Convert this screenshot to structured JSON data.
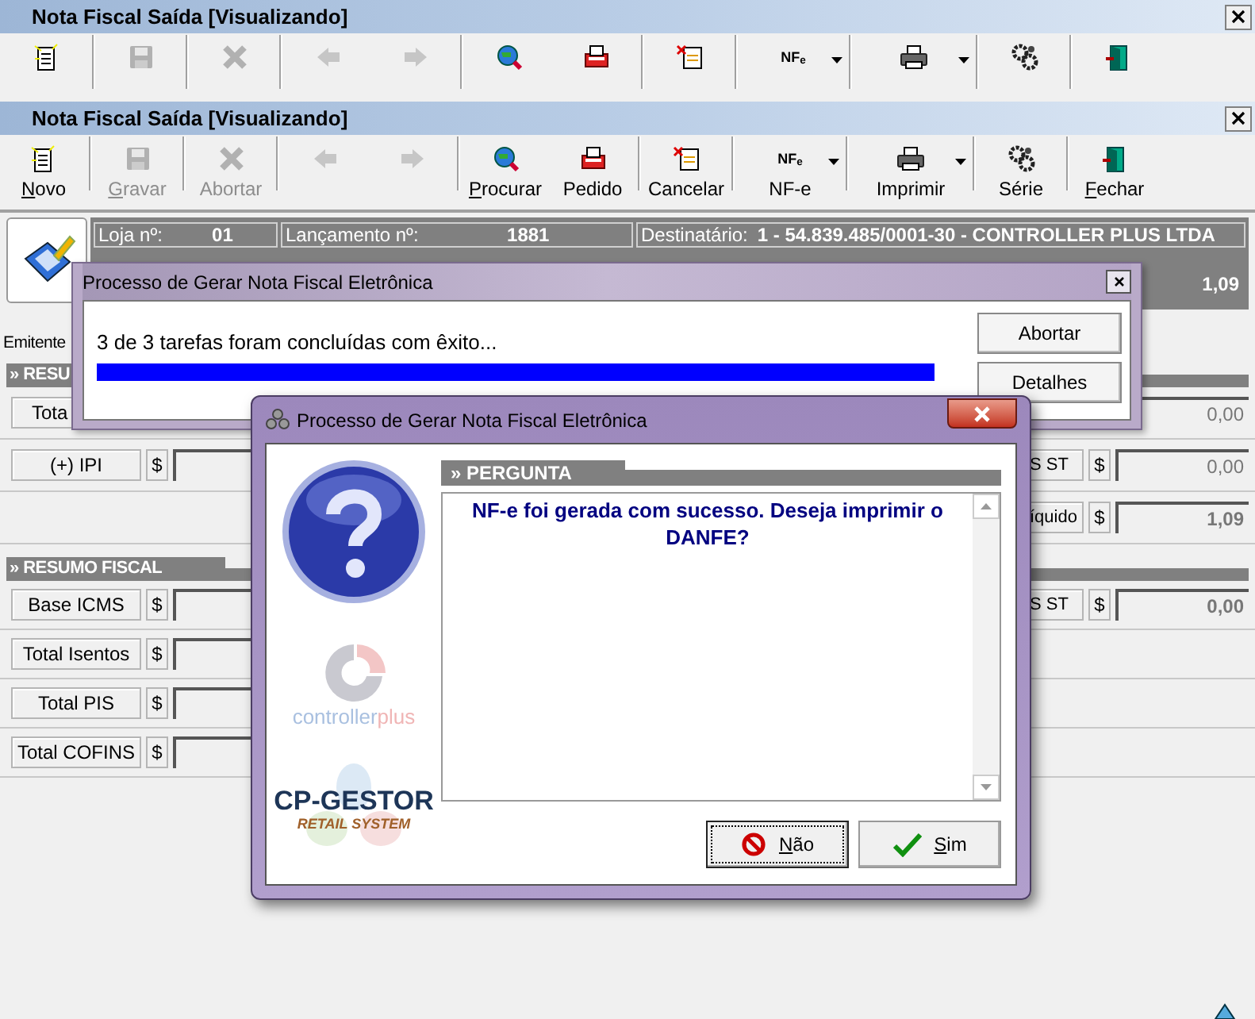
{
  "back_window": {
    "title": "Nota Fiscal Saída [Visualizando]",
    "toolbar_groups": [
      [
        {
          "kind": "new",
          "disabled": false
        }
      ],
      [
        {
          "kind": "save",
          "disabled": true
        }
      ],
      [
        {
          "kind": "abort",
          "disabled": true
        }
      ],
      [
        {
          "kind": "back",
          "disabled": true
        },
        {
          "kind": "forward",
          "disabled": true
        }
      ],
      [
        {
          "kind": "search",
          "disabled": false
        },
        {
          "kind": "order",
          "disabled": false
        }
      ],
      [
        {
          "kind": "cancel",
          "disabled": false
        }
      ],
      [
        {
          "kind": "nfe",
          "disabled": false,
          "dropdown": true,
          "icon_text": "NF$_{e}$"
        }
      ],
      [
        {
          "kind": "print",
          "disabled": false,
          "dropdown": true
        }
      ],
      [
        {
          "kind": "series",
          "disabled": false
        }
      ],
      [
        {
          "kind": "exit",
          "disabled": false
        }
      ]
    ]
  },
  "window": {
    "title": "Nota Fiscal Saída [Visualizando]",
    "toolbar_groups": [
      [
        {
          "kind": "new",
          "label": "Novo",
          "mnemonic": true,
          "disabled": false
        }
      ],
      [
        {
          "kind": "save",
          "label": "Gravar",
          "mnemonic": true,
          "disabled": true
        }
      ],
      [
        {
          "kind": "abort",
          "label": "Abortar",
          "mnemonic": false,
          "disabled": true
        }
      ],
      [
        {
          "kind": "back",
          "disabled": true
        },
        {
          "kind": "forward",
          "disabled": true
        }
      ],
      [
        {
          "kind": "search",
          "label": "Procurar",
          "mnemonic": true,
          "disabled": false
        },
        {
          "kind": "order",
          "label": "Pedido",
          "mnemonic": false,
          "disabled": false
        }
      ],
      [
        {
          "kind": "cancel",
          "label": "Cancelar",
          "mnemonic": false,
          "disabled": false
        }
      ],
      [
        {
          "kind": "nfe",
          "label": "NF-e",
          "mnemonic": false,
          "disabled": false,
          "dropdown": true,
          "icon_text": "NF$_{e}$"
        }
      ],
      [
        {
          "kind": "print",
          "label": "Imprimir",
          "mnemonic": false,
          "disabled": false,
          "dropdown": true
        }
      ],
      [
        {
          "kind": "series",
          "label": "Série",
          "mnemonic": false,
          "disabled": false
        }
      ],
      [
        {
          "kind": "exit",
          "label": "Fechar",
          "mnemonic": true,
          "disabled": false
        }
      ]
    ]
  },
  "header": {
    "fields": [
      {
        "label": "Loja nº:",
        "value": "01"
      },
      {
        "label": "Lançamento nº:",
        "value": "1881"
      },
      {
        "label": "Destinatário:",
        "value": "1 - 54.839.485/0001-30 - CONTROLLER PLUS  LTDA"
      }
    ],
    "total": "1,09"
  },
  "emitente": "Emitente",
  "summary": {
    "title": "» RESU",
    "rows": [
      {
        "left": {
          "label": "Tota",
          "cut": true
        },
        "right": {
          "value": "0,00"
        }
      },
      {
        "left": {
          "label": "(+) IPI",
          "currency": "$"
        },
        "right": {
          "label": "S ST",
          "currency": "$",
          "value": "0,00"
        }
      },
      {
        "right": {
          "label": "íquido",
          "currency": "$",
          "value": "1,09",
          "bold": true
        }
      }
    ]
  },
  "fiscal": {
    "title": "» RESUMO FISCAL",
    "rows": [
      {
        "left": {
          "label": "Base ICMS",
          "currency": "$"
        },
        "right": {
          "label": "S ST",
          "currency": "$",
          "value": "0,00",
          "bold": true
        }
      },
      {
        "left": {
          "label": "Total Isentos",
          "currency": "$"
        }
      },
      {
        "left": {
          "label": "Total PIS",
          "currency": "$"
        }
      },
      {
        "left": {
          "label": "Total COFINS",
          "currency": "$"
        }
      }
    ]
  },
  "progress_dialog": {
    "title": "Processo de Gerar Nota Fiscal Eletrônica",
    "message": "3 de 3 tarefas foram concluídas com êxito...",
    "level": 1,
    "buttons": [
      "Abortar",
      "Detalhes"
    ]
  },
  "question_dialog": {
    "title": "Processo de Gerar Nota Fiscal Eletrônica",
    "logo_text": "controller",
    "logo_text_accent": "plus",
    "brand": "CP-GESTOR",
    "brand_tagline": "RETAIL SYSTEM",
    "section": "» PERGUNTA",
    "message": "NF-e foi gerada com sucesso. Deseja imprimir o DANFE?",
    "buttons": [
      {
        "kind": "no",
        "label": "Não",
        "mnemonic": true,
        "focused": true
      },
      {
        "kind": "yes",
        "label": "Sim",
        "mnemonic": true,
        "focused": false
      }
    ]
  }
}
